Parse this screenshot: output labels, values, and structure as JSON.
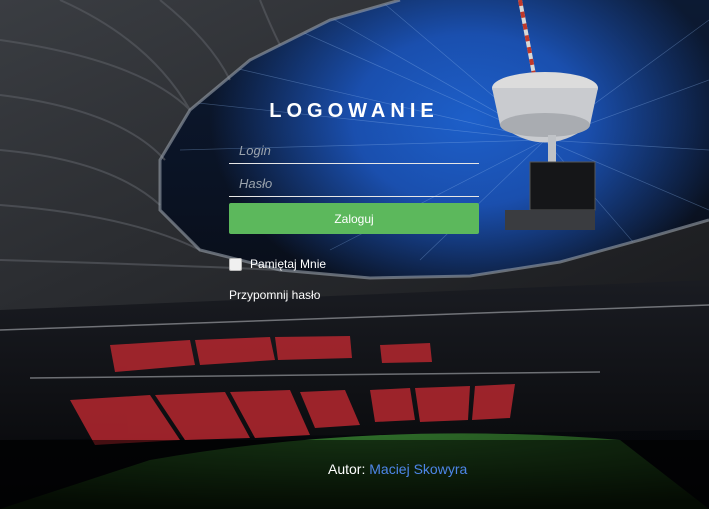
{
  "login": {
    "title": "LOGOWANIE",
    "login_placeholder": "Login",
    "password_placeholder": "Hasło",
    "submit_label": "Zaloguj",
    "remember_label": "Pamiętaj Mnie",
    "remind_link": "Przypomnij hasło"
  },
  "footer": {
    "author_label": "Autor:",
    "author_name": "Maciej Skowyra"
  },
  "colors": {
    "submit_button": "#5cb85c",
    "author_link": "#4d86e8",
    "text": "#ffffff"
  }
}
